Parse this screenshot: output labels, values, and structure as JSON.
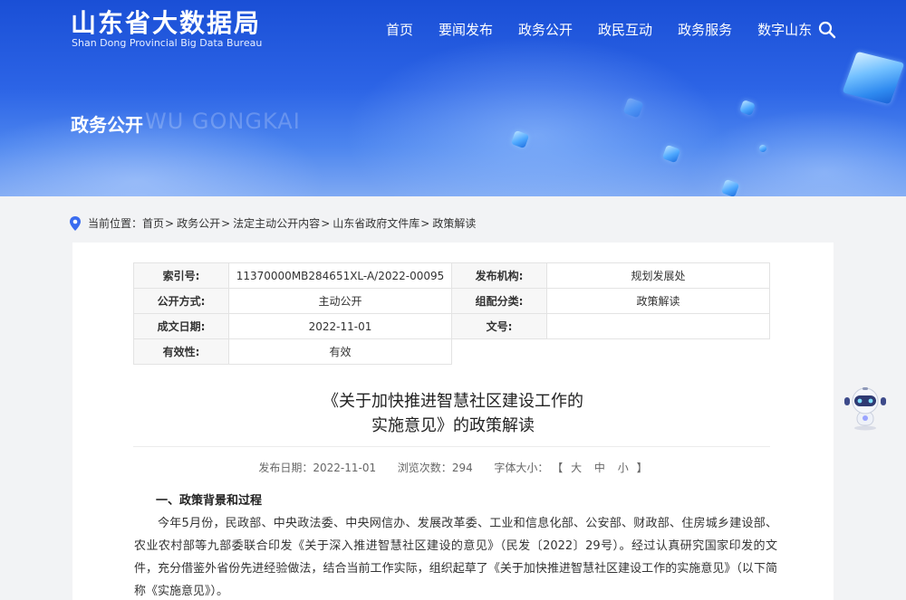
{
  "header": {
    "logo_cn": "山东省大数据局",
    "logo_en": "Shan Dong Provincial Big Data Bureau",
    "nav": [
      "首页",
      "要闻发布",
      "政务公开",
      "政民互动",
      "政务服务",
      "数字山东"
    ],
    "search_icon": "search-icon"
  },
  "banner": {
    "title": "政务公开",
    "subtitle": "WU GONGKAI"
  },
  "breadcrumb": {
    "prefix": "当前位置：",
    "items": [
      "首页",
      "政务公开",
      "法定主动公开内容",
      "山东省政府文件库",
      "政策解读"
    ],
    "sep": ">"
  },
  "meta": {
    "rows": [
      [
        {
          "k": "索引号:",
          "v": "11370000MB284651XL-A/2022-00095"
        },
        {
          "k": "发布机构:",
          "v": "规划发展处"
        }
      ],
      [
        {
          "k": "公开方式:",
          "v": "主动公开"
        },
        {
          "k": "组配分类:",
          "v": "政策解读"
        }
      ],
      [
        {
          "k": "成文日期:",
          "v": "2022-11-01"
        },
        {
          "k": "文号:",
          "v": ""
        }
      ],
      [
        {
          "k": "有效性:",
          "v": "有效"
        }
      ]
    ]
  },
  "article": {
    "title_line1": "《关于加快推进智慧社区建设工作的",
    "title_line2": "实施意见》的政策解读",
    "publish_label": "发布日期：",
    "publish_date": "2022-11-01",
    "views_label": "浏览次数：",
    "views": "294",
    "fontsize_label": "字体大小：",
    "bracket_open": "【",
    "font_large": "大",
    "font_medium": "中",
    "font_small": "小",
    "bracket_close": "】",
    "section1": "一、政策背景和过程",
    "para1": "今年5月份，民政部、中央政法委、中央网信办、发展改革委、工业和信息化部、公安部、财政部、住房城乡建设部、农业农村部等九部委联合印发《关于深入推进智慧社区建设的意见》（民发〔2022〕29号）。经过认真研究国家印发的文件，充分借鉴外省份先进经验做法，结合当前工作实际，组织起草了《关于加快推进智慧社区建设工作的实施意见》（以下简称《实施意见》）。"
  },
  "colors": {
    "banner_blue": "#2c64e6",
    "accent_blue": "#3a6cf0"
  }
}
